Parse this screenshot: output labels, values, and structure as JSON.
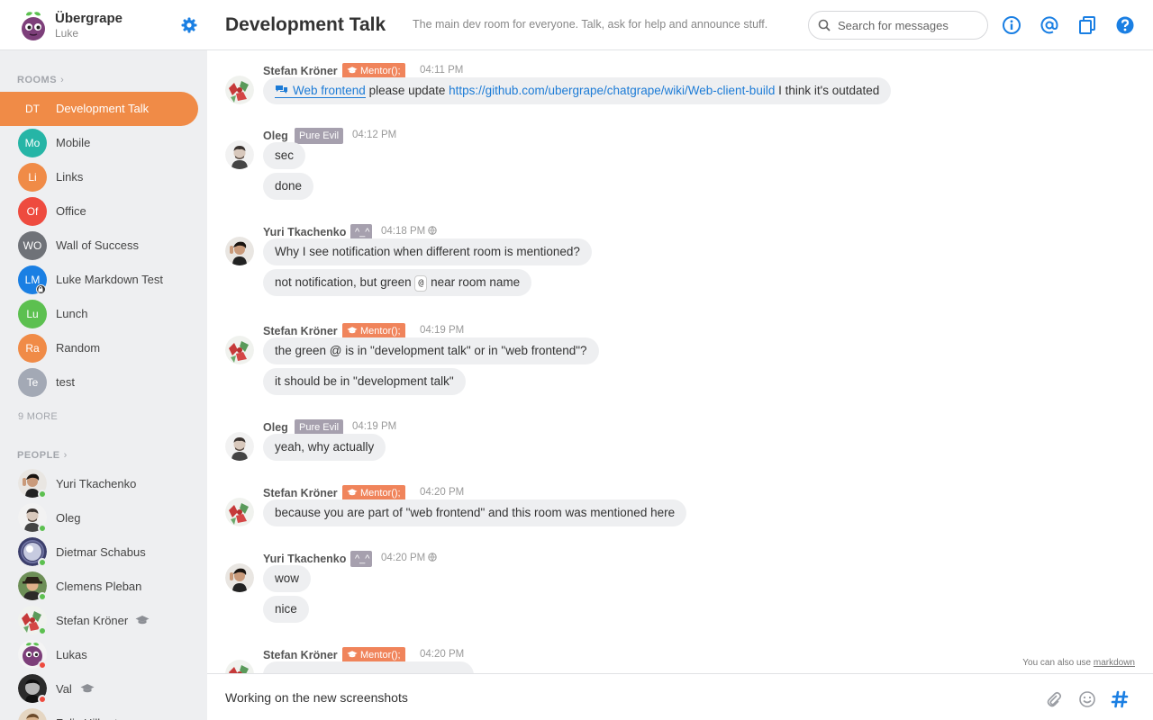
{
  "org": {
    "name": "Übergrape",
    "user": "Luke"
  },
  "sidebar": {
    "rooms_heading": "ROOMS",
    "rooms": [
      {
        "initials": "DT",
        "label": "Development Talk",
        "color": "#f08b47",
        "active": true
      },
      {
        "initials": "Mo",
        "label": "Mobile",
        "color": "#26b5a6"
      },
      {
        "initials": "Li",
        "label": "Links",
        "color": "#f08b47"
      },
      {
        "initials": "Of",
        "label": "Office",
        "color": "#ee4b3f"
      },
      {
        "initials": "WO",
        "label": "Wall of Success",
        "color": "#6f7278"
      },
      {
        "initials": "LM",
        "label": "Luke Markdown Test",
        "color": "#1a7fe3",
        "private": true
      },
      {
        "initials": "Lu",
        "label": "Lunch",
        "color": "#5cc050"
      },
      {
        "initials": "Ra",
        "label": "Random",
        "color": "#f08b47"
      },
      {
        "initials": "Te",
        "label": "test",
        "color": "#a3a9b5"
      }
    ],
    "more": "9 MORE",
    "people_heading": "PEOPLE",
    "people": [
      {
        "label": "Yuri Tkachenko",
        "status_color": "#5cc050"
      },
      {
        "label": "Oleg",
        "status_color": "#5cc050"
      },
      {
        "label": "Dietmar Schabus",
        "status_color": "#5cc050"
      },
      {
        "label": "Clemens Pleban",
        "status_color": "#5cc050"
      },
      {
        "label": "Stefan Kröner",
        "status_color": "#5cc050",
        "mentor": true
      },
      {
        "label": "Lukas",
        "status_color": "#ee4b3f"
      },
      {
        "label": "Val",
        "status_color": "#ee4b3f",
        "mentor": true
      },
      {
        "label": "Felix Hilbert",
        "status_color": "#ee4b3f"
      }
    ]
  },
  "header": {
    "title": "Development Talk",
    "description": "The main dev room for everyone. Talk, ask for help and announce stuff.",
    "search_placeholder": "Search for messages"
  },
  "messages": [
    {
      "author": "Stefan Kröner",
      "badge": "Mentor();",
      "time": "04:11 PM",
      "lines": [
        {
          "room_link": "Web frontend",
          "text_a": " please update ",
          "url": "https://github.com/ubergrape/chatgrape/wiki/Web-client-build",
          "text_b": " I think it's outdated"
        }
      ]
    },
    {
      "author": "Oleg",
      "badge": "Pure Evil",
      "time": "04:12 PM",
      "lines": [
        "sec",
        "done"
      ]
    },
    {
      "author": "Yuri Tkachenko",
      "badge": "^_^",
      "time": "04:18 PM",
      "lines": [
        "Why I see notification when different room is mentioned?",
        {
          "pre": "not notification, but green ",
          "code": "@",
          "post": " near room name"
        }
      ]
    },
    {
      "author": "Stefan Kröner",
      "badge": "Mentor();",
      "time": "04:19 PM",
      "lines": [
        "the green @ is in \"development talk\" or in \"web frontend\"?",
        "it should be in \"development talk\""
      ]
    },
    {
      "author": "Oleg",
      "badge": "Pure Evil",
      "time": "04:19 PM",
      "lines": [
        "yeah, why actually"
      ]
    },
    {
      "author": "Stefan Kröner",
      "badge": "Mentor();",
      "time": "04:20 PM",
      "lines": [
        "because you are part of \"web frontend\" and this room was mentioned here"
      ]
    },
    {
      "author": "Yuri Tkachenko",
      "badge": "^_^",
      "time": "04:20 PM",
      "lines": [
        "wow",
        "nice"
      ]
    },
    {
      "author": "Stefan Kröner",
      "badge": "Mentor();",
      "time": "04:20 PM",
      "lines": []
    }
  ],
  "composer": {
    "hint_text": "You can also use",
    "hint_link": "markdown",
    "value": "Working on the new screenshots"
  },
  "colors": {
    "accent": "#f08b47",
    "link": "#1c7bd6",
    "icon_blue": "#1a7fe3"
  }
}
